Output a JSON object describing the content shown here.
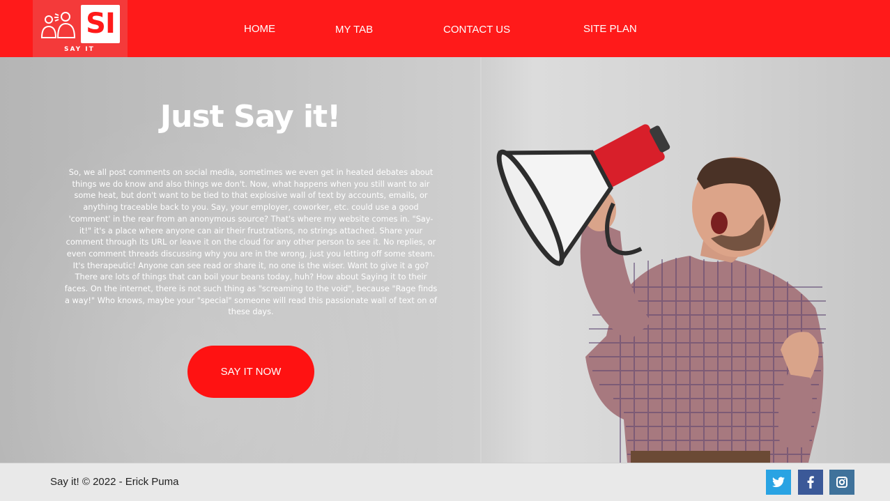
{
  "header": {
    "logo_caption": "SAY IT",
    "logo_mark": "SI",
    "nav": [
      {
        "label": "HOME"
      },
      {
        "label": "MY TAB"
      },
      {
        "label": "CONTACT US"
      },
      {
        "label": "SITE PLAN"
      }
    ],
    "bg_color": "#ff1a1a"
  },
  "hero": {
    "title": "Just Say it!",
    "body": "So, we all post comments on social media, sometimes we even get in heated debates about things we do know and also things we don't. Now, what happens when you still want to air some heat, but don't want to be tied to that explosive wall of text by accounts, emails, or anything traceable back to you. Say, your employer, coworker, etc. could use a good 'comment' in the rear from an anonymous source? That's where my website comes in. \"Say-it!\" it's a place where anyone can air their frustrations, no strings attached. Share your comment through its URL or leave it on the cloud for any other person to see it. No replies, or even comment threads discussing why you are in the wrong, just you letting off some steam. It's therapeutic! Anyone can see read or share it, no one is the wiser. Want to give it a go? There are lots of things that can boil your beans today, huh? How about Saying it to their faces. On the internet, there is not such thing as \"screaming to the void\", because \"Rage finds a way!\" Who knows, maybe your \"special\" someone will read this passionate wall of text on of these days.",
    "cta_label": "SAY IT NOW",
    "accent_color": "#ff1212",
    "image": "man-with-megaphone"
  },
  "footer": {
    "copyright": "Say it! © 2022 - Erick Puma",
    "social": [
      {
        "icon": "twitter-icon",
        "color": "#29a3e3"
      },
      {
        "icon": "facebook-icon",
        "color": "#3b5998"
      },
      {
        "icon": "instagram-icon",
        "color": "#3f729b"
      }
    ]
  }
}
